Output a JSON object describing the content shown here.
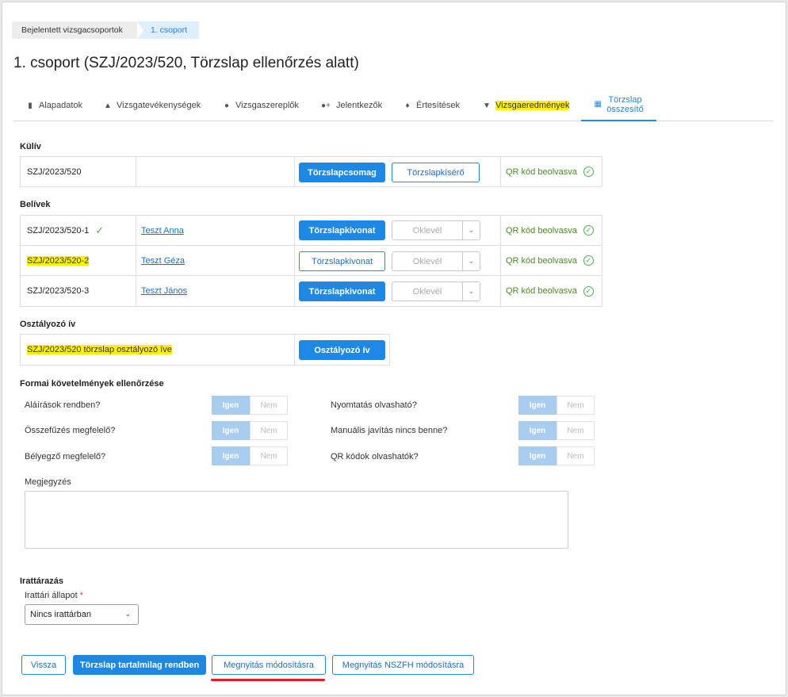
{
  "breadcrumb": {
    "items": [
      "Bejelentett vizsgacsoportok",
      "1. csoport"
    ]
  },
  "page_title": "1. csoport (SZJ/2023/520, Törzslap ellenőrzés alatt)",
  "tabs": [
    {
      "label": "Alapadatok",
      "icon": "document-icon"
    },
    {
      "label": "Vizsgatevékenységek",
      "icon": "graduation-cap-icon"
    },
    {
      "label": "Vizsgaszereplők",
      "icon": "person-icon"
    },
    {
      "label": "Jelentkezők",
      "icon": "add-user-icon"
    },
    {
      "label": "Értesítések",
      "icon": "bell-icon"
    },
    {
      "label": "Vizsgaeredmények",
      "icon": "trophy-icon"
    },
    {
      "label_line1": "Törzslap",
      "label_line2": "összesítő",
      "icon": "form-icon"
    }
  ],
  "kuliv": {
    "heading": "Külív",
    "row": {
      "code": "SZJ/2023/520",
      "btn1": "Törzslapcsomag",
      "btn2": "Törzslapkísérő",
      "status": "QR kód beolvasva"
    }
  },
  "beliv": {
    "heading": "Belívek",
    "rows": [
      {
        "code": "SZJ/2023/520-1",
        "name": "Teszt Anna",
        "btn": "Törzslapkivonat",
        "select": "Oklevél",
        "status": "QR kód beolvasva"
      },
      {
        "code": "SZJ/2023/520-2",
        "name": "Teszt Géza",
        "btn": "Törzslapkivonat",
        "select": "Oklevél",
        "status": "QR kód beolvasva"
      },
      {
        "code": "SZJ/2023/520-3",
        "name": "Teszt János",
        "btn": "Törzslapkivonat",
        "select": "Oklevél",
        "status": "QR kód beolvasva"
      }
    ]
  },
  "osztalyozo": {
    "heading": "Osztályozó ív",
    "text": "SZJ/2023/520 törzslap osztályozó íve",
    "btn": "Osztályozó ív"
  },
  "formai": {
    "heading": "Formai követelmények ellenőrzése",
    "yes": "Igen",
    "no": "Nem",
    "left": [
      "Aláírások rendben?",
      "Összefűzés megfelelő?",
      "Bélyegző megfelelő?"
    ],
    "right": [
      "Nyomtatás olvasható?",
      "Manuális javítás nincs benne?",
      "QR kódok olvashatók?"
    ]
  },
  "megjegyzes": {
    "label": "Megjegyzés",
    "value": ""
  },
  "irattarazas": {
    "heading": "Irattárazás",
    "field_label": "Irattári állapot",
    "required_mark": "*",
    "value": "Nincs irattárban"
  },
  "footer": {
    "back": "Vissza",
    "ok": "Törzslap tartalmilag rendben",
    "reopen": "Megnyitás módosításra",
    "reopen_nszfh": "Megnyitás NSZFH módosításra"
  },
  "colors": {
    "accent": "#1e88e5",
    "highlight": "#fff200",
    "success": "#4caf50",
    "underline": "#e02020"
  }
}
